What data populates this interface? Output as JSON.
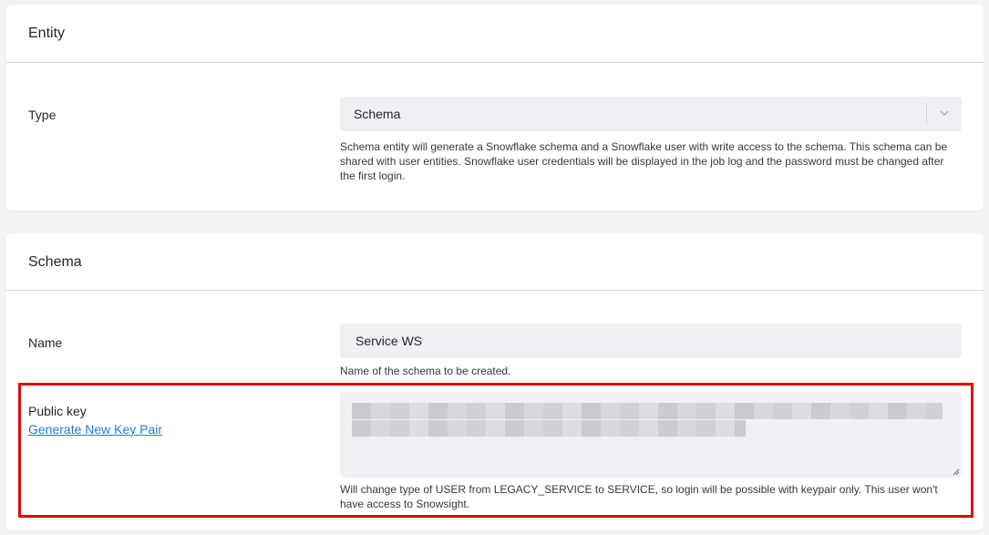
{
  "entity_card": {
    "title": "Entity",
    "type_label": "Type",
    "type_select": {
      "value": "Schema"
    },
    "type_help": "Schema entity will generate a Snowflake schema and a Snowflake user with write access to the schema. This schema can be shared with user entities. Snowflake user credentials will be displayed in the job log and the password must be changed after the first login."
  },
  "schema_card": {
    "title": "Schema",
    "name_label": "Name",
    "name_input": {
      "value": "Service WS"
    },
    "name_help": "Name of the schema to be created.",
    "public_key_label": "Public key",
    "generate_link": "Generate New Key Pair",
    "public_key_help": "Will change type of USER from LEGACY_SERVICE to SERVICE, so login will be possible with keypair only. This user won't have access to Snowsight."
  },
  "colors": {
    "accent_link": "#1f7ad6",
    "highlight_border": "#e10a0a",
    "field_bg": "#eef0f4"
  },
  "icons": {
    "select_chevron": "chevron-down-icon",
    "textarea_resize": "resize-handle-icon"
  }
}
